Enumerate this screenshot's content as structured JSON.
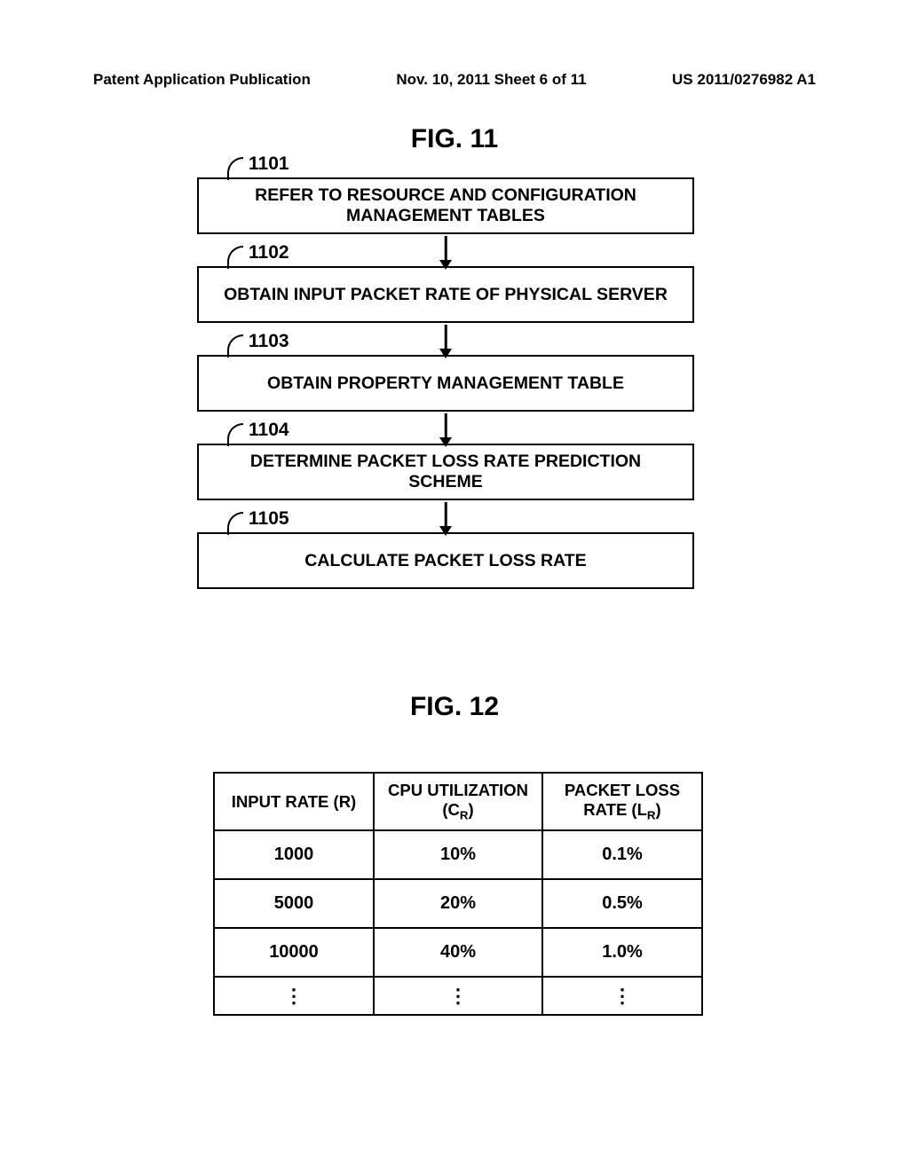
{
  "header": {
    "left": "Patent Application Publication",
    "mid": "Nov. 10, 2011  Sheet 6 of 11",
    "right": "US 2011/0276982 A1"
  },
  "fig11": {
    "title": "FIG. 11",
    "steps": [
      {
        "ref": "1101",
        "text": "REFER TO RESOURCE AND CONFIGURATION MANAGEMENT TABLES"
      },
      {
        "ref": "1102",
        "text": "OBTAIN INPUT PACKET RATE OF PHYSICAL SERVER"
      },
      {
        "ref": "1103",
        "text": "OBTAIN PROPERTY MANAGEMENT TABLE"
      },
      {
        "ref": "1104",
        "text": "DETERMINE PACKET LOSS RATE PREDICTION SCHEME"
      },
      {
        "ref": "1105",
        "text": "CALCULATE PACKET LOSS RATE"
      }
    ]
  },
  "fig12": {
    "title": "FIG. 12",
    "columns": {
      "r": "INPUT RATE (R)",
      "c_pre": "CPU UTILIZATION (C",
      "c_sub": "R",
      "c_post": ")",
      "l_pre": "PACKET LOSS RATE (L",
      "l_sub": "R",
      "l_post": ")"
    },
    "rows": [
      {
        "r": "1000",
        "c": "10%",
        "l": "0.1%"
      },
      {
        "r": "5000",
        "c": "20%",
        "l": "0.5%"
      },
      {
        "r": "10000",
        "c": "40%",
        "l": "1.0%"
      },
      {
        "r": "⋮",
        "c": "⋮",
        "l": "⋮"
      }
    ]
  },
  "chart_data": {
    "type": "table",
    "title": "FIG. 12",
    "columns": [
      "INPUT RATE (R)",
      "CPU UTILIZATION (C_R)",
      "PACKET LOSS RATE (L_R)"
    ],
    "rows": [
      [
        1000,
        "10%",
        "0.1%"
      ],
      [
        5000,
        "20%",
        "0.5%"
      ],
      [
        10000,
        "40%",
        "1.0%"
      ]
    ],
    "note": "table continues (ellipsis row)"
  }
}
